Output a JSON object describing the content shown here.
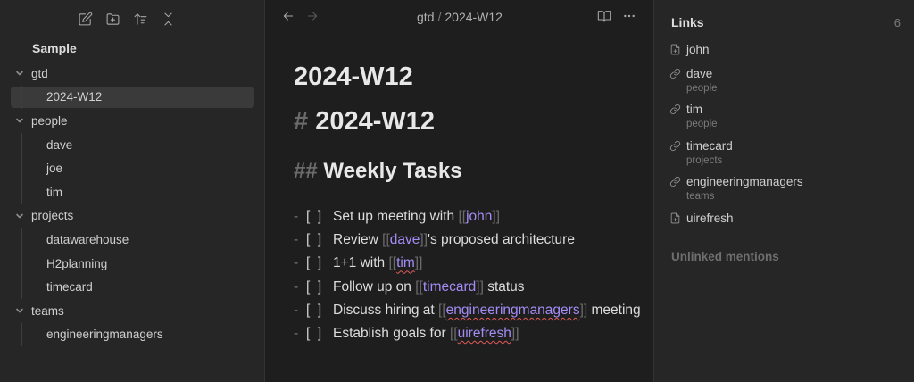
{
  "sidebar": {
    "vault_name": "Sample",
    "tree": [
      {
        "type": "folder",
        "label": "gtd",
        "name": "folder-gtd"
      },
      {
        "type": "file",
        "label": "2024-W12",
        "name": "file-2024-w12",
        "active": true
      },
      {
        "type": "folder",
        "label": "people",
        "name": "folder-people"
      },
      {
        "type": "file",
        "label": "dave",
        "name": "file-dave"
      },
      {
        "type": "file",
        "label": "joe",
        "name": "file-joe"
      },
      {
        "type": "file",
        "label": "tim",
        "name": "file-tim"
      },
      {
        "type": "folder",
        "label": "projects",
        "name": "folder-projects"
      },
      {
        "type": "file",
        "label": "datawarehouse",
        "name": "file-datawarehouse"
      },
      {
        "type": "file",
        "label": "H2planning",
        "name": "file-h2planning"
      },
      {
        "type": "file",
        "label": "timecard",
        "name": "file-timecard"
      },
      {
        "type": "folder",
        "label": "teams",
        "name": "folder-teams"
      },
      {
        "type": "file",
        "label": "engineeringmanagers",
        "name": "file-engineeringmanagers"
      }
    ],
    "toolbar_icons": [
      "new-note-icon",
      "new-folder-icon",
      "sort-icon",
      "collapse-all-icon"
    ]
  },
  "editor": {
    "breadcrumb": {
      "folder": "gtd",
      "sep": "/",
      "note": "2024-W12"
    },
    "title": "2024-W12",
    "h1": {
      "marker": "#",
      "text": "2024-W12"
    },
    "h2": {
      "marker": "##",
      "text": "Weekly Tasks"
    },
    "tasks": [
      {
        "parts": [
          {
            "t": "Set up meeting with "
          },
          {
            "t": "[[",
            "c": "br"
          },
          {
            "t": "john",
            "c": "lnk"
          },
          {
            "t": "]]",
            "c": "br"
          }
        ]
      },
      {
        "parts": [
          {
            "t": "Review "
          },
          {
            "t": "[[",
            "c": "br"
          },
          {
            "t": "dave",
            "c": "lnk"
          },
          {
            "t": "]]",
            "c": "br"
          },
          {
            "t": "'s proposed architecture"
          }
        ]
      },
      {
        "parts": [
          {
            "t": "1+1 with "
          },
          {
            "t": "[[",
            "c": "br"
          },
          {
            "t": "tim",
            "c": "lnk squig"
          },
          {
            "t": "]]",
            "c": "br"
          }
        ]
      },
      {
        "parts": [
          {
            "t": "Follow up on "
          },
          {
            "t": "[[",
            "c": "br"
          },
          {
            "t": "timecard",
            "c": "lnk"
          },
          {
            "t": "]]",
            "c": "br"
          },
          {
            "t": " status"
          }
        ]
      },
      {
        "parts": [
          {
            "t": "Discuss hiring at "
          },
          {
            "t": "[[",
            "c": "br"
          },
          {
            "t": "engineeringmanagers",
            "c": "lnk squig"
          },
          {
            "t": "]]",
            "c": "br"
          },
          {
            "t": " meeting"
          }
        ]
      },
      {
        "parts": [
          {
            "t": "Establish goals for "
          },
          {
            "t": "[[",
            "c": "br"
          },
          {
            "t": "uirefresh",
            "c": "lnk squig"
          },
          {
            "t": "]]",
            "c": "br"
          }
        ]
      }
    ],
    "task_dash": "-",
    "task_box": "[  ]"
  },
  "links_panel": {
    "title": "Links",
    "count": "6",
    "items": [
      {
        "name": "john",
        "sub": "",
        "icon": "file-plus-icon"
      },
      {
        "name": "dave",
        "sub": "people",
        "icon": "link-icon"
      },
      {
        "name": "tim",
        "sub": "people",
        "icon": "link-icon"
      },
      {
        "name": "timecard",
        "sub": "projects",
        "icon": "link-icon"
      },
      {
        "name": "engineeringmanagers",
        "sub": "teams",
        "icon": "link-icon"
      },
      {
        "name": "uirefresh",
        "sub": "",
        "icon": "file-plus-icon"
      }
    ],
    "unlinked_label": "Unlinked mentions"
  }
}
